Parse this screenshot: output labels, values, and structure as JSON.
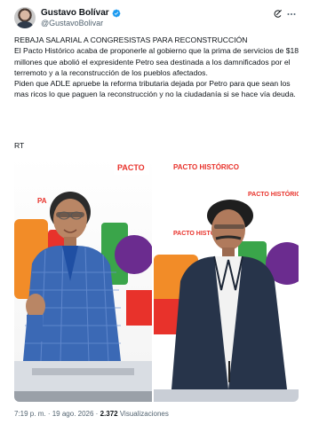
{
  "author": {
    "name": "Gustavo Bolívar",
    "handle": "@GustavoBolivar"
  },
  "post": {
    "headline": "REBAJA SALARIAL A CONGRESISTAS PARA RECONSTRUCCIÓN",
    "paragraph1": "El Pacto Histórico acaba de proponerle al gobierno que la prima de servicios de $18 millones que abolió el expresidente Petro sea destinada a los damnificados por el terremoto y a la reconstrucción de los pueblos afectados.",
    "paragraph2": "Piden que ADLE apruebe la reforma tributaria dejada por Petro para que sean los mas ricos lo que paguen la reconstrucción y no la ciudadanía si se hace vía deuda.",
    "rt": "RT"
  },
  "media": {
    "left_banner": "PACTO HISTÓRICO",
    "left_banner_small": "PACTO",
    "right_banner": "PACTO HISTÓRICO",
    "right_banner_2": "PACTO HISTÓRICO",
    "right_banner_3": "PACTO HISTÓRICO"
  },
  "footer": {
    "time": "7:19 p. m.",
    "separator": "·",
    "date": "19 ago. 2026",
    "views_count": "2.372",
    "views_label": "Visualizaciones"
  },
  "icons": {
    "verified": "verified-badge-icon",
    "grok": "grok-icon",
    "more": "more-options-icon"
  },
  "colors": {
    "verified": "#1d9bf0",
    "secondary_text": "#536471",
    "pacto_red": "#e8322b",
    "pacto_purple": "#6b2c8f",
    "pacto_orange": "#f28c28",
    "pacto_green": "#3aa54a"
  }
}
